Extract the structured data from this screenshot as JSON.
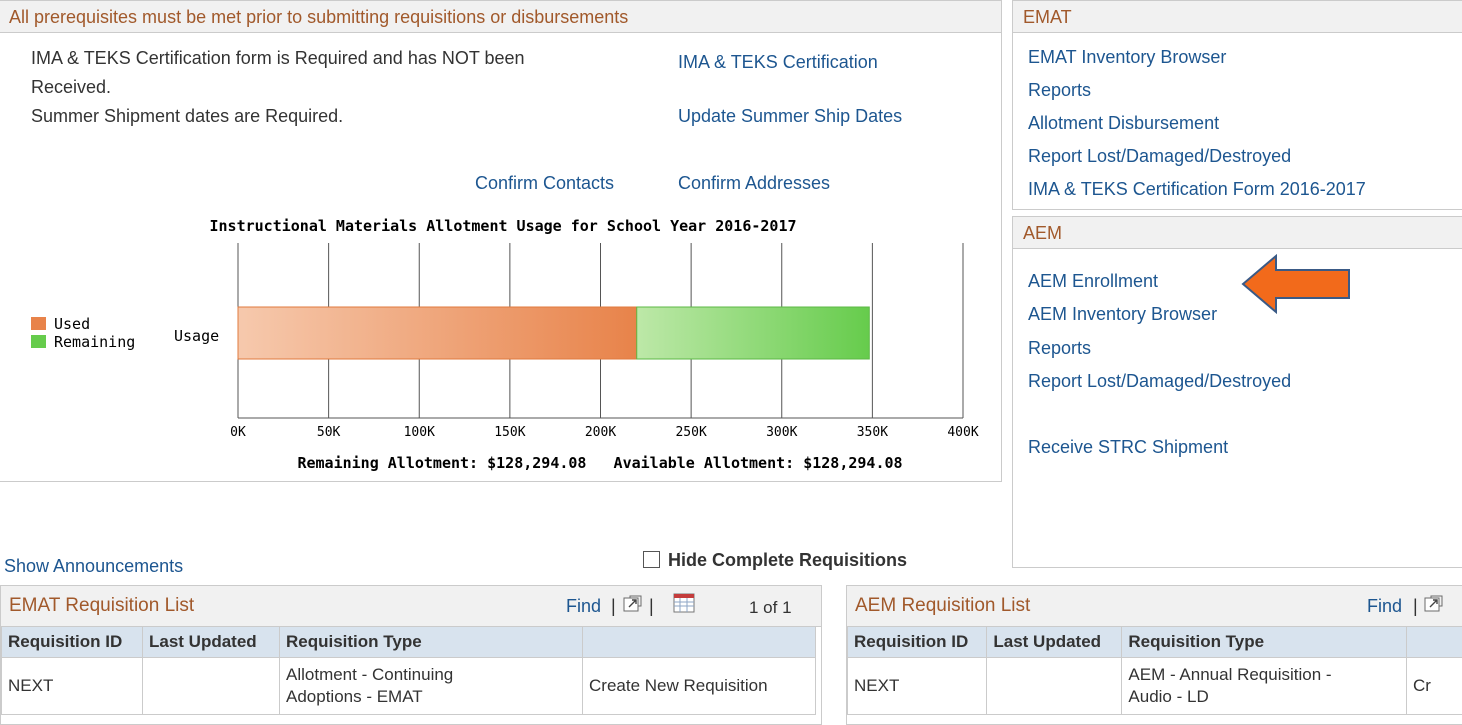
{
  "prereq": {
    "title": "All prerequisites must be met prior to submitting requisitions or disbursements",
    "msg1_line1": "IMA & TEKS Certification form is Required and has NOT been",
    "msg1_line2": "Received.",
    "msg2": "Summer Shipment dates are Required.",
    "link_cert": "IMA & TEKS Certification",
    "link_ship": "Update Summer Ship Dates",
    "link_contacts": "Confirm Contacts",
    "link_addresses": "Confirm Addresses"
  },
  "chart_data": {
    "type": "bar",
    "orientation": "horizontal",
    "stacked": true,
    "title": "Instructional Materials Allotment Usage for School Year 2016-2017",
    "categories": [
      "Usage"
    ],
    "series": [
      {
        "name": "Used",
        "values": [
          220000
        ],
        "color": "#e8834a"
      },
      {
        "name": "Remaining",
        "values": [
          128294.08
        ],
        "color": "#66cc4c"
      }
    ],
    "xlim": [
      0,
      400000
    ],
    "xticks": [
      "0K",
      "50K",
      "100K",
      "150K",
      "200K",
      "250K",
      "300K",
      "350K",
      "400K"
    ],
    "grid": true,
    "legend_position": "left",
    "footer": "Remaining Allotment: $128,294.08   Available Allotment: $128,294.08"
  },
  "emat_panel": {
    "title": "EMAT",
    "links": [
      "EMAT Inventory Browser",
      "Reports",
      "Allotment Disbursement",
      "Report Lost/Damaged/Destroyed",
      "IMA & TEKS Certification Form 2016-2017"
    ]
  },
  "aem_panel": {
    "title": "AEM",
    "links": [
      "AEM Enrollment",
      "AEM Inventory Browser",
      "Reports",
      "Report Lost/Damaged/Destroyed"
    ],
    "extra_link": "Receive STRC Shipment"
  },
  "show_announcements": "Show Announcements",
  "hide_complete": {
    "label": "Hide Complete Requisitions",
    "checked": false
  },
  "emat_req": {
    "title": "EMAT Requisition List",
    "find": "Find",
    "separator": "|",
    "pager": "1 of 1",
    "columns": [
      "Requisition ID",
      "Last Updated",
      "Requisition Type",
      ""
    ],
    "row": {
      "id": "NEXT",
      "updated": "",
      "type_line1": "Allotment - Continuing",
      "type_line2": "Adoptions - EMAT",
      "action": "Create New Requisition"
    }
  },
  "aem_req": {
    "title": "AEM Requisition List",
    "find": "Find",
    "separator": "|",
    "columns": [
      "Requisition ID",
      "Last Updated",
      "Requisition Type",
      ""
    ],
    "row": {
      "id": "NEXT",
      "updated": "",
      "type_line1": "AEM - Annual Requisition -",
      "type_line2": "Audio - LD",
      "action": "Cr"
    }
  },
  "icons": {
    "popout": "new-window-icon",
    "grid": "spreadsheet-icon",
    "arrow": "pointer-arrow-icon"
  },
  "colors": {
    "link": "#1d5690",
    "heading": "#a1592b",
    "header_bg": "#f1f1f1",
    "col_header_bg": "#d8e3ee",
    "arrow": "#f26a1b"
  }
}
